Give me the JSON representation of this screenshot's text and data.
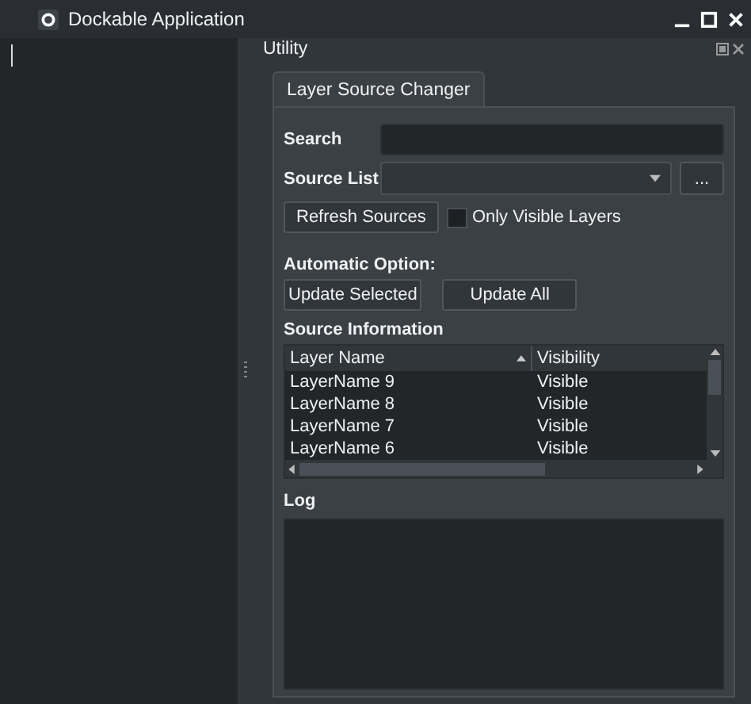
{
  "window": {
    "title": "Dockable Application"
  },
  "dock": {
    "title": "Utility"
  },
  "tabs": [
    {
      "label": "Layer Source Changer",
      "selected": true
    }
  ],
  "search": {
    "label": "Search"
  },
  "source_list": {
    "label": "Source List",
    "browse_button": "..."
  },
  "refresh_button": "Refresh Sources",
  "only_visible": {
    "label": "Only Visible Layers",
    "checked": false
  },
  "automatic_option": {
    "label": "Automatic Option:",
    "buttons": [
      "Update Selected",
      "Update All"
    ]
  },
  "source_information": {
    "label": "Source Information",
    "columns": [
      "Layer Name",
      "Visibility"
    ],
    "rows": [
      [
        "LayerName 9",
        "Visible"
      ],
      [
        "LayerName 8",
        "Visible"
      ],
      [
        "LayerName 7",
        "Visible"
      ],
      [
        "LayerName 6",
        "Visible"
      ]
    ]
  },
  "log": {
    "label": "Log"
  }
}
